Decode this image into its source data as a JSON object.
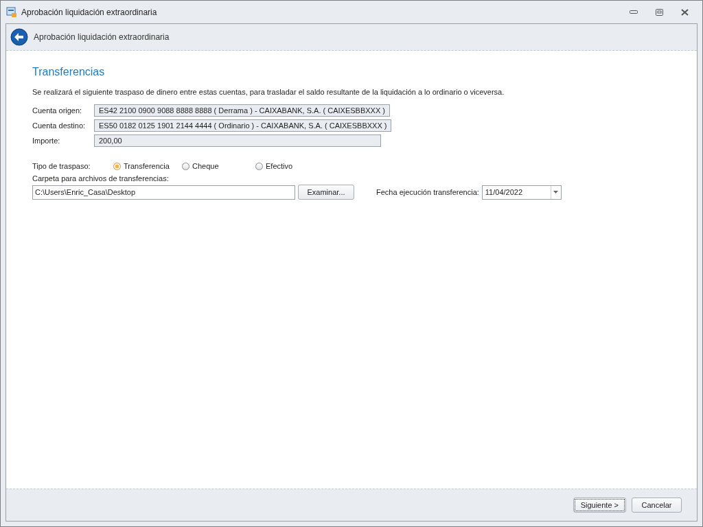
{
  "window": {
    "title": "Aprobación liquidación extraordinaria"
  },
  "header": {
    "title": "Aprobación liquidación extraordinaria"
  },
  "section_title": "Transferencias",
  "description": "Se realizará el siguiente traspaso de dinero entre estas cuentas, para trasladar el saldo resultante de la liquidación a lo ordinario o viceversa.",
  "fields": [
    {
      "label": "Cuenta origen:",
      "value": "ES42 2100 0900 9088 8888 8888 ( Derrama ) - CAIXABANK, S.A. ( CAIXESBBXXX )",
      "kind": "wide"
    },
    {
      "label": "Cuenta destino:",
      "value": "ES50 0182 0125 1901 2144 4444 ( Ordinario ) - CAIXABANK, S.A. ( CAIXESBBXXX )",
      "kind": "wide"
    },
    {
      "label": "Importe:",
      "value": "200,00",
      "kind": "narrow"
    }
  ],
  "transfer_type": {
    "label": "Tipo de traspaso:",
    "options": [
      {
        "label": "Transferencia",
        "selected": true
      },
      {
        "label": "Cheque",
        "selected": false
      },
      {
        "label": "Efectivo",
        "selected": false
      }
    ]
  },
  "folder": {
    "label": "Carpeta para archivos de transferencias:",
    "value": "C:\\Users\\Enric_Casa\\Desktop",
    "browse_button": "Examinar..."
  },
  "execution_date": {
    "label": "Fecha ejecución transferencia:",
    "value": "11/04/2022"
  },
  "buttons": [
    {
      "label": "Siguiente >",
      "focused": true
    },
    {
      "label": "Cancelar",
      "focused": false
    }
  ]
}
